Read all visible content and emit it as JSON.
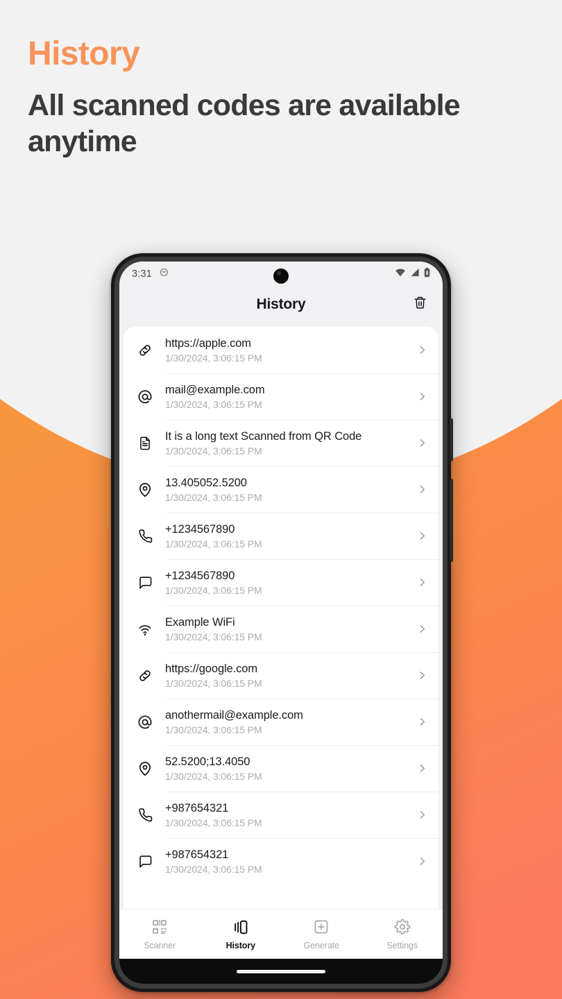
{
  "promo": {
    "title": "History",
    "subtitle": "All scanned codes are available anytime",
    "title_color": "#F8935A",
    "subtitle_color": "#3A3A3C",
    "bg_color": "#F2F2F2",
    "accent_top": "#F9953F",
    "accent_bottom": "#FB7B5C"
  },
  "phone": {
    "statusbar": {
      "time": "3:31",
      "left_icon": "circle-icon",
      "icons": [
        "wifi-icon",
        "cellular-signal-icon",
        "battery-icon"
      ]
    },
    "header": {
      "title": "History",
      "delete_icon": "trash-icon"
    },
    "history_items": [
      {
        "icon": "link-icon",
        "title": "https://apple.com",
        "date": "1/30/2024, 3:06:15 PM"
      },
      {
        "icon": "at-icon",
        "title": "mail@example.com",
        "date": "1/30/2024, 3:06:15 PM"
      },
      {
        "icon": "document-icon",
        "title": "It is a long text Scanned from QR Code",
        "date": "1/30/2024, 3:06:15 PM"
      },
      {
        "icon": "location-icon",
        "title": "13.405052.5200",
        "date": "1/30/2024, 3:06:15 PM"
      },
      {
        "icon": "phone-icon",
        "title": "+1234567890",
        "date": "1/30/2024, 3:06:15 PM"
      },
      {
        "icon": "message-icon",
        "title": "+1234567890",
        "date": "1/30/2024, 3:06:15 PM"
      },
      {
        "icon": "wifi-icon",
        "title": "Example WiFi",
        "date": "1/30/2024, 3:06:15 PM"
      },
      {
        "icon": "link-icon",
        "title": "https://google.com",
        "date": "1/30/2024, 3:06:15 PM"
      },
      {
        "icon": "at-icon",
        "title": "anothermail@example.com",
        "date": "1/30/2024, 3:06:15 PM"
      },
      {
        "icon": "location-icon",
        "title": "52.5200;13.4050",
        "date": "1/30/2024, 3:06:15 PM"
      },
      {
        "icon": "phone-icon",
        "title": "+987654321",
        "date": "1/30/2024, 3:06:15 PM"
      },
      {
        "icon": "message-icon",
        "title": "+987654321",
        "date": "1/30/2024, 3:06:15 PM"
      }
    ],
    "bottom_nav": [
      {
        "label": "Scanner",
        "icon": "qr-code-icon",
        "active": false
      },
      {
        "label": "History",
        "icon": "cards-stack-icon",
        "active": true
      },
      {
        "label": "Generate",
        "icon": "plus-box-icon",
        "active": false
      },
      {
        "label": "Settings",
        "icon": "gear-icon",
        "active": false
      }
    ]
  }
}
